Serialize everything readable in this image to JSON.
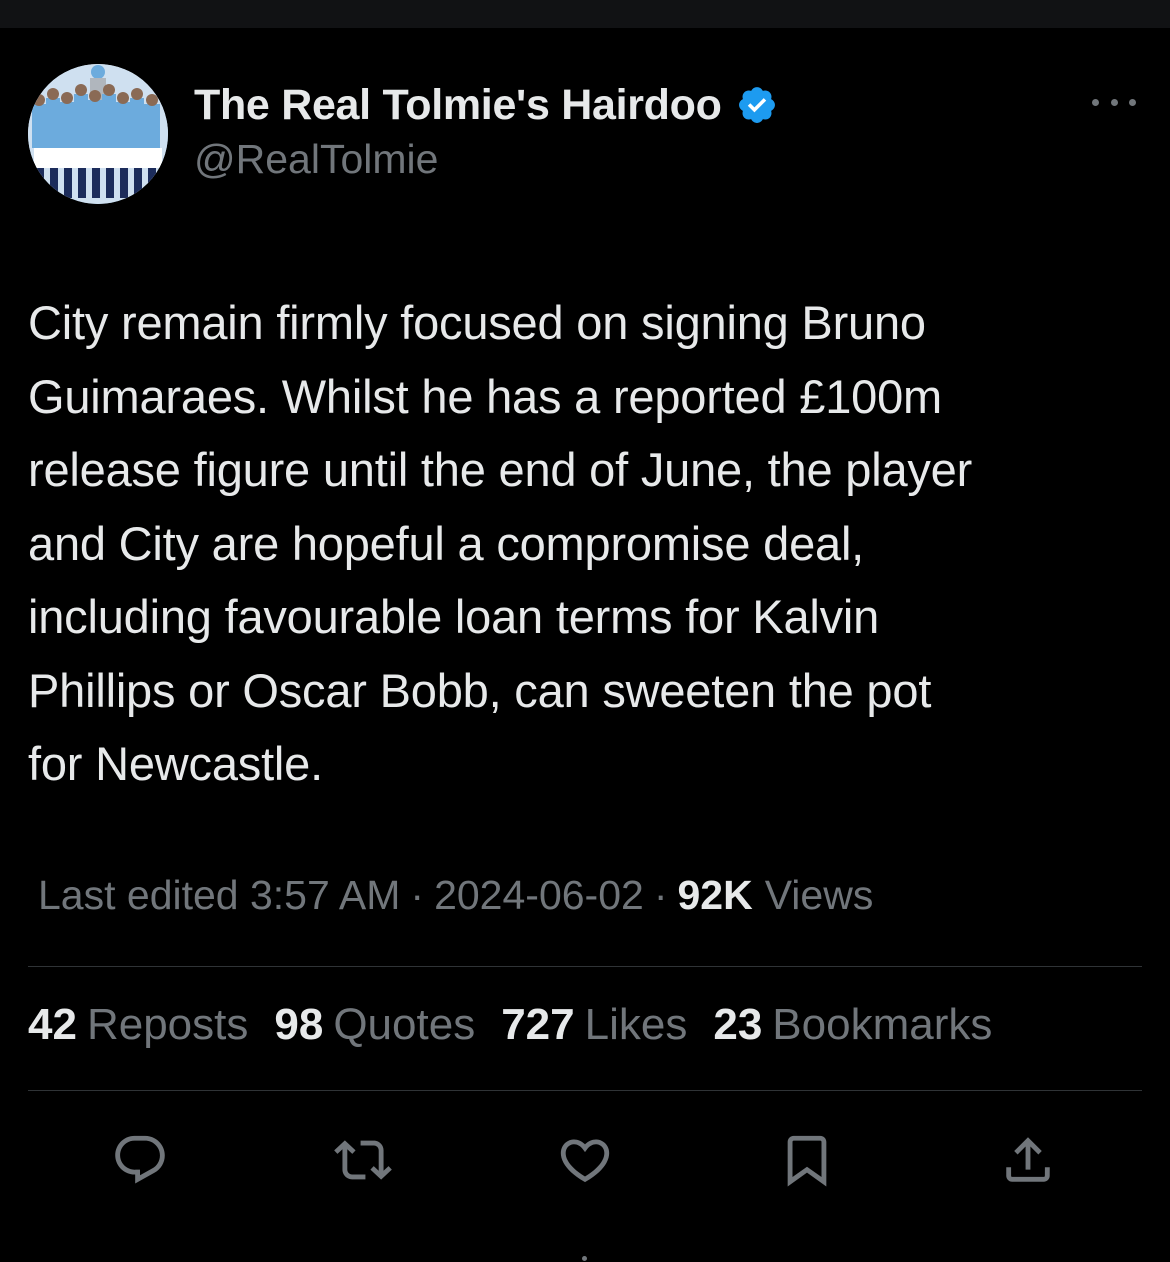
{
  "author": {
    "display_name": "The Real Tolmie's Hairdoo",
    "handle": "@RealTolmie",
    "verified": true
  },
  "tweet": {
    "text": "City remain firmly focused on signing Bruno\nGuimaraes. Whilst he has a reported £100m\nrelease figure until the end of June, the player\nand City are hopeful a compromise deal,\nincluding  favourable loan terms for Kalvin\nPhillips or Oscar Bobb, can sweeten the pot\nfor Newcastle."
  },
  "meta": {
    "edited": "Last edited 3:57 AM",
    "separator": "·",
    "date": "2024-06-02",
    "views_count": "92K",
    "views_label": "Views"
  },
  "stats": [
    {
      "count": "42",
      "label": "Reposts"
    },
    {
      "count": "98",
      "label": "Quotes"
    },
    {
      "count": "727",
      "label": "Likes"
    },
    {
      "count": "23",
      "label": "Bookmarks"
    }
  ],
  "actions": [
    "reply-icon",
    "repost-icon",
    "like-icon",
    "bookmark-icon",
    "share-icon"
  ],
  "colors": {
    "background": "#000000",
    "text_primary": "#e7e9ea",
    "text_secondary": "#71767b",
    "divider": "#2f3336",
    "verified": "#1d9bf0"
  }
}
